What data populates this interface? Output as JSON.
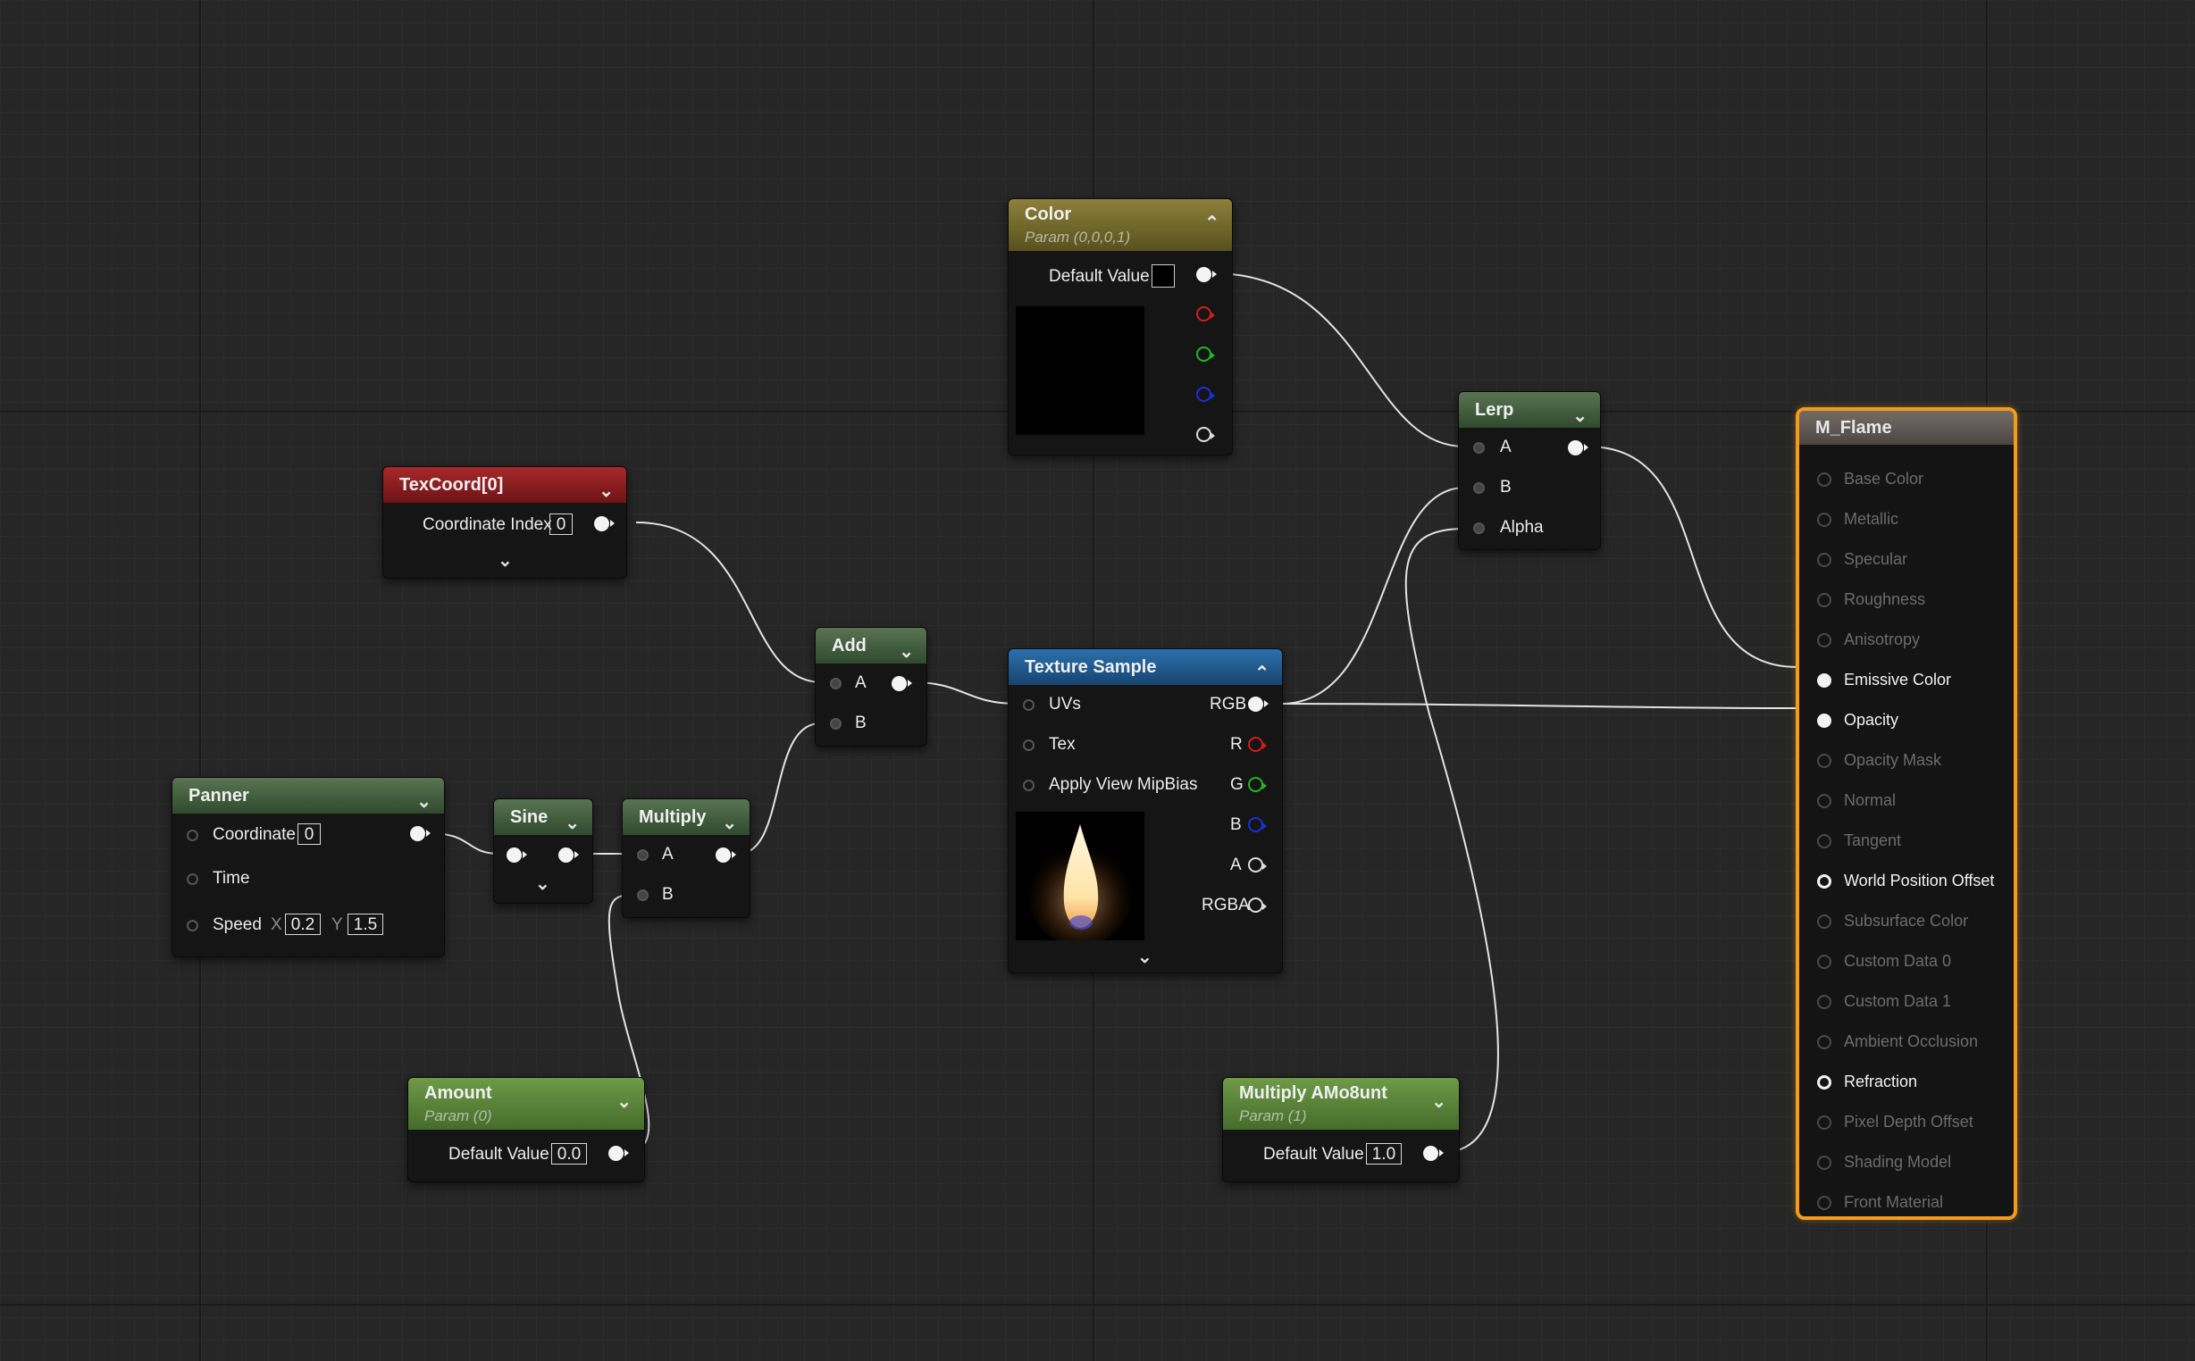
{
  "nodes": {
    "color": {
      "title": "Color",
      "subtitle": "Param (0,0,0,1)",
      "default_label": "Default Value",
      "default_value_hex": "#000000"
    },
    "texcoord": {
      "title": "TexCoord[0]",
      "coord_label": "Coordinate Index",
      "coord_value": "0"
    },
    "add": {
      "title": "Add",
      "in_a": "A",
      "in_b": "B"
    },
    "panner": {
      "title": "Panner",
      "coord_label": "Coordinate",
      "coord_value": "0",
      "time_label": "Time",
      "speed_label": "Speed",
      "x_label": "X",
      "x_value": "0.2",
      "y_label": "Y",
      "y_value": "1.5"
    },
    "sine": {
      "title": "Sine"
    },
    "multiply": {
      "title": "Multiply",
      "in_a": "A",
      "in_b": "B"
    },
    "texture": {
      "title": "Texture Sample",
      "in_uvs": "UVs",
      "in_tex": "Tex",
      "in_mip": "Apply View MipBias",
      "out_rgb": "RGB",
      "out_r": "R",
      "out_g": "G",
      "out_b": "B",
      "out_a": "A",
      "out_rgba": "RGBA",
      "preview_icon": "flame-texture"
    },
    "lerp": {
      "title": "Lerp",
      "in_a": "A",
      "in_b": "B",
      "in_alpha": "Alpha"
    },
    "amount": {
      "title": "Amount",
      "subtitle": "Param (0)",
      "default_label": "Default Value",
      "default_value": "0.0"
    },
    "multiply_amount": {
      "title": "Multiply AMo8unt",
      "subtitle": "Param (1)",
      "default_label": "Default Value",
      "default_value": "1.0"
    }
  },
  "result": {
    "title": "M_Flame",
    "inputs": [
      {
        "label": "Base Color",
        "active": false
      },
      {
        "label": "Metallic",
        "active": false
      },
      {
        "label": "Specular",
        "active": false
      },
      {
        "label": "Roughness",
        "active": false
      },
      {
        "label": "Anisotropy",
        "active": false
      },
      {
        "label": "Emissive Color",
        "active": true
      },
      {
        "label": "Opacity",
        "active": true
      },
      {
        "label": "Opacity Mask",
        "active": false
      },
      {
        "label": "Normal",
        "active": false
      },
      {
        "label": "Tangent",
        "active": false
      },
      {
        "label": "World Position Offset",
        "active": true
      },
      {
        "label": "Subsurface Color",
        "active": false
      },
      {
        "label": "Custom Data 0",
        "active": false
      },
      {
        "label": "Custom Data 1",
        "active": false
      },
      {
        "label": "Ambient Occlusion",
        "active": false
      },
      {
        "label": "Refraction",
        "active": true
      },
      {
        "label": "Pixel Depth Offset",
        "active": false
      },
      {
        "label": "Shading Model",
        "active": false
      },
      {
        "label": "Front Material",
        "active": false
      }
    ]
  },
  "colors": {
    "selection_outline": "#f39b1a",
    "wire": "#e6e6e6",
    "grid_bg": "#262626"
  }
}
